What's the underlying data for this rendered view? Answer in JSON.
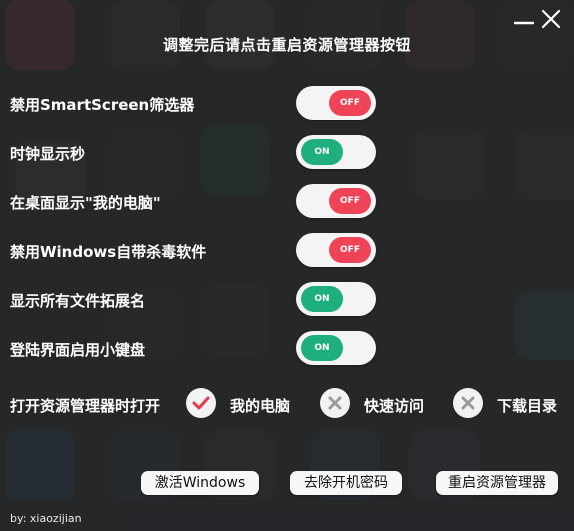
{
  "title": "调整完后请点击重启资源管理器按钮",
  "window": {
    "minimize_icon": "minimize-icon",
    "close_icon": "close-icon"
  },
  "toggles": [
    {
      "label": "禁用SmartScreen筛选器",
      "state": "OFF"
    },
    {
      "label": "时钟显示秒",
      "state": "ON"
    },
    {
      "label": "在桌面显示\"我的电脑\"",
      "state": "OFF"
    },
    {
      "label": "禁用Windows自带杀毒软件",
      "state": "OFF"
    },
    {
      "label": "显示所有文件拓展名",
      "state": "ON"
    },
    {
      "label": "登陆界面启用小键盘",
      "state": "ON"
    }
  ],
  "open_with": {
    "label": "打开资源管理器时打开",
    "options": [
      {
        "label": "我的电脑",
        "selected": true,
        "icon": "check-icon"
      },
      {
        "label": "快速访问",
        "selected": false,
        "icon": "x-icon"
      },
      {
        "label": "下载目录",
        "selected": false,
        "icon": "x-icon"
      }
    ]
  },
  "buttons": {
    "activate": "激活Windows",
    "remove_password": "去除开机密码",
    "restart_explorer": "重启资源管理器"
  },
  "footer": "by: xiaozijian",
  "colors": {
    "toggle_on": "#1faf7f",
    "toggle_off": "#ef4457",
    "check": "#e23b4a",
    "x_mark": "#9a9a9a"
  }
}
